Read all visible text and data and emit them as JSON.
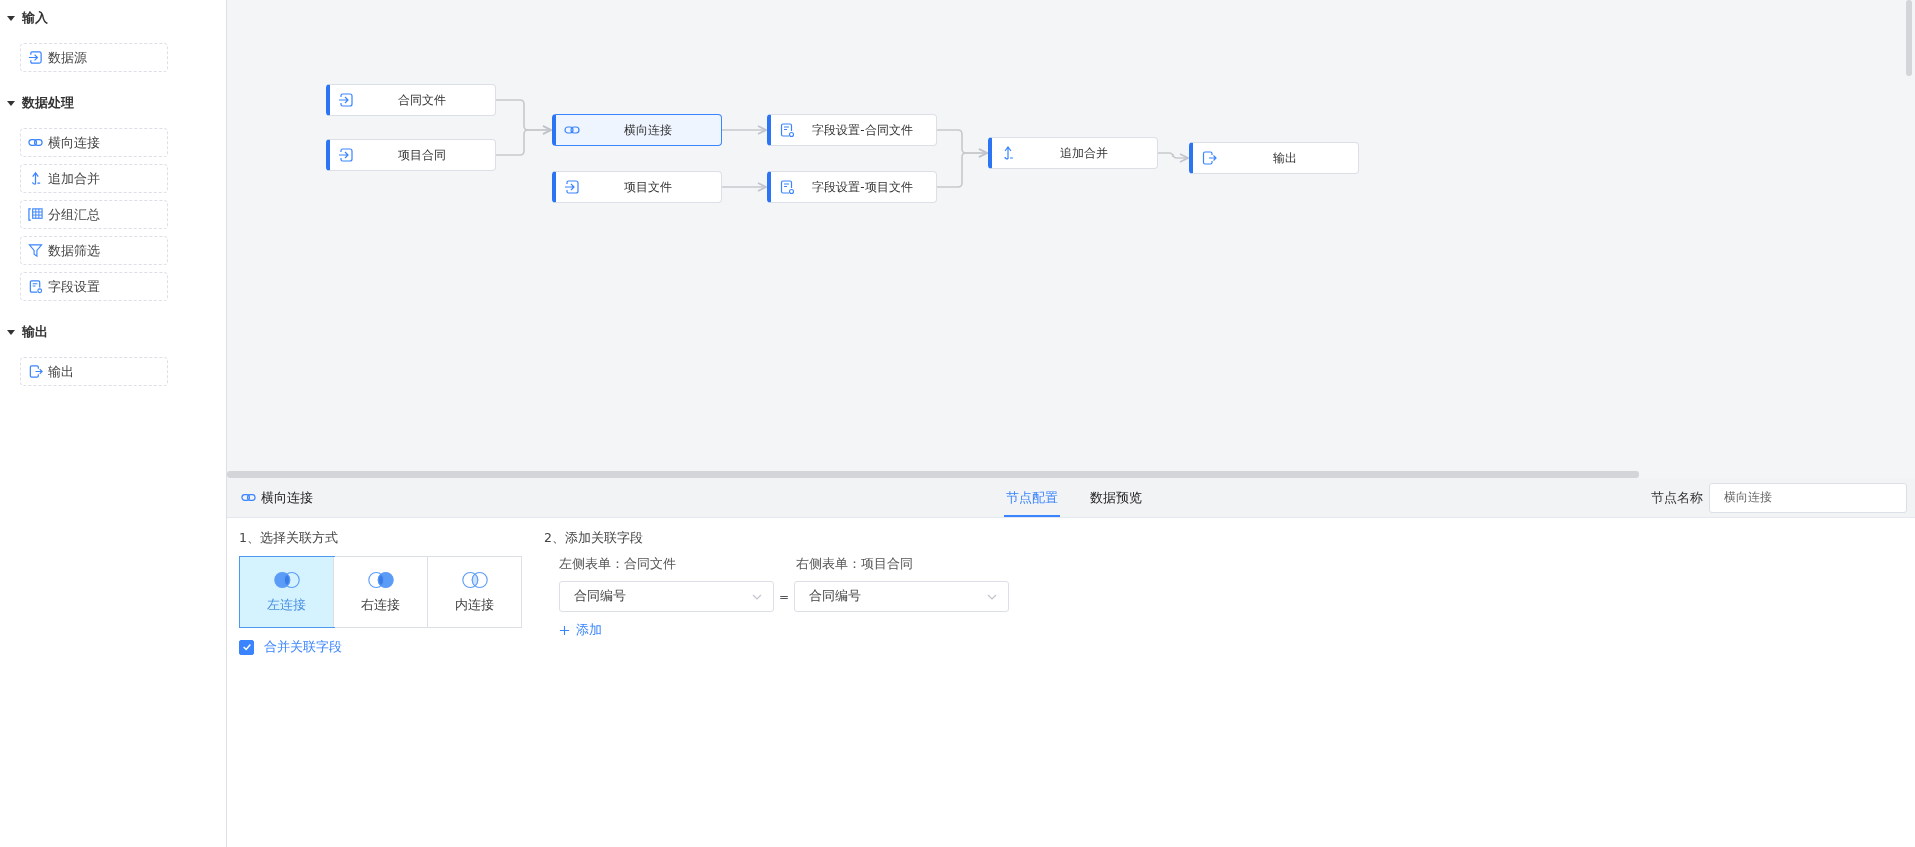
{
  "sidebar": {
    "groups": [
      {
        "title": "输入",
        "expanded": true,
        "items": [
          {
            "label": "数据源",
            "kind": "source"
          }
        ]
      },
      {
        "title": "数据处理",
        "expanded": true,
        "items": [
          {
            "label": "横向连接",
            "kind": "join"
          },
          {
            "label": "追加合并",
            "kind": "append"
          },
          {
            "label": "分组汇总",
            "kind": "group"
          },
          {
            "label": "数据筛选",
            "kind": "filter"
          },
          {
            "label": "字段设置",
            "kind": "field"
          }
        ]
      },
      {
        "title": "输出",
        "expanded": true,
        "items": [
          {
            "label": "输出",
            "kind": "output"
          }
        ]
      }
    ]
  },
  "canvas": {
    "nodes": [
      {
        "label": "合同文件",
        "kind": "source",
        "selected": false
      },
      {
        "label": "项目合同",
        "kind": "source",
        "selected": false
      },
      {
        "label": "横向连接",
        "kind": "join",
        "selected": true
      },
      {
        "label": "项目文件",
        "kind": "source",
        "selected": false
      },
      {
        "label": "字段设置-合同文件",
        "kind": "field",
        "selected": false
      },
      {
        "label": "字段设置-项目文件",
        "kind": "field",
        "selected": false
      },
      {
        "label": "追加合并",
        "kind": "append",
        "selected": false
      },
      {
        "label": "输出",
        "kind": "output",
        "selected": false
      }
    ]
  },
  "panel": {
    "title": "横向连接",
    "tabs": [
      {
        "label": "节点配置",
        "selected": true
      },
      {
        "label": "数据预览",
        "selected": false
      }
    ],
    "name_field": {
      "label": "节点名称",
      "value": "横向连接"
    },
    "join_section": {
      "heading": "1、选择关联方式",
      "options": [
        {
          "label": "左连接",
          "kind": "left",
          "selected": true
        },
        {
          "label": "右连接",
          "kind": "right",
          "selected": false
        },
        {
          "label": "内连接",
          "kind": "inner",
          "selected": false
        }
      ],
      "merge_checkbox": {
        "label": "合并关联字段",
        "checked": true
      }
    },
    "fields_section": {
      "heading": "2、添加关联字段",
      "left_label": "左侧表单：合同文件",
      "right_label": "右侧表单：项目合同",
      "pairs": [
        {
          "left": "合同编号",
          "operator": "=",
          "right": "合同编号"
        }
      ],
      "add_label": "添加"
    }
  }
}
